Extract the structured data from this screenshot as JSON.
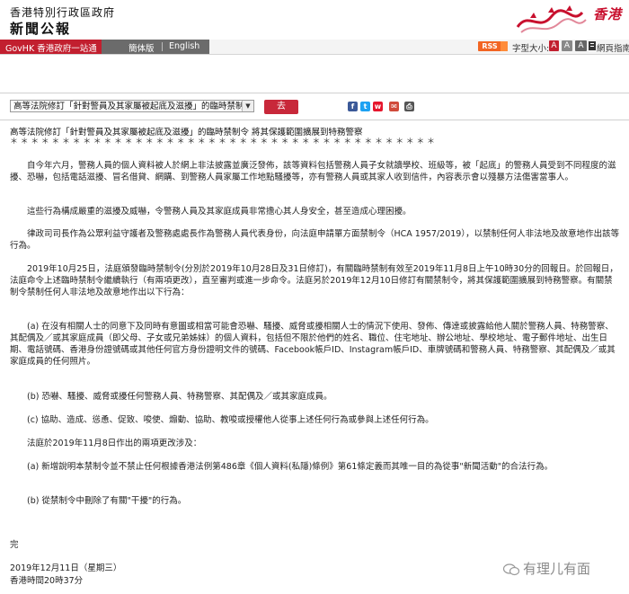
{
  "header": {
    "gov_name": "香港特別行政區政府",
    "site_title": "新聞公報",
    "brand_text": "香港"
  },
  "nav": {
    "gov_link": "GovHK 香港政府一站通",
    "simplified": "簡体版",
    "english": "English",
    "rss": "RSS",
    "font_size_label": "字型大小:",
    "font_small": "A",
    "font_mid": "A",
    "font_large": "A",
    "sitemap": "網頁指南"
  },
  "selector": {
    "selected": "高等法院修訂「針對警員及其家屬被起底及滋擾」的臨時禁制",
    "go_label": "去"
  },
  "share_icons": [
    "facebook-icon",
    "twitter-icon",
    "weibo-icon",
    "email-icon",
    "print-icon"
  ],
  "article": {
    "title": "高等法院修訂「針對警員及其家屬被起底及滋擾」的臨時禁制令 將其保護範圍擴展到特務警察",
    "separator": "＊＊＊＊＊＊＊＊＊＊＊＊＊＊＊＊＊＊＊＊＊＊＊＊＊＊＊＊＊＊＊＊＊＊＊＊＊＊＊＊＊",
    "paragraphs": [
      "　　自今年六月，警務人員的個人資料被人於網上非法披露並廣泛發佈，該等資料包括警務人員子女就讀學校、班級等，被「起底」的警務人員受到不同程度的滋擾、恐嚇，包括電話滋擾、冒名借貸、網購、到警務人員家屬工作地點騷擾等，亦有警務人員或其家人收到信件，內容表示會以殘暴方法傷害當事人。",
      "　　這些行為構成嚴重的滋擾及威嚇，令警務人員及其家庭成員非常擔心其人身安全，甚至造成心理困擾。",
      "　　律政司司長作為公眾利益守護者及警務處處長作為警務人員代表身份，向法庭申請單方面禁制令（HCA 1957/2019），以禁制任何人非法地及故意地作出該等行為。",
      "　　2019年10月25日，法庭頒發臨時禁制令(分別於2019年10月28日及31日修訂)，有關臨時禁制有效至2019年11月8日上午10時30分的回報日。於回報日，法庭命令上述臨時禁制令繼續執行（有兩項更改），直至審判或進一步命令。法庭另於2019年12月10日修訂有關禁制令，將其保護範圍擴展到特務警察。有關禁制令禁制任何人非法地及故意地作出以下行為：",
      "　　(a) 在沒有相關人士的同意下及同時有意圖或相當可能會恐嚇、騷擾、威脅或擾相關人士的情況下使用、發佈、傳達或披露給他人關於警務人員、特務警察、其配偶及／或其家庭成員（即父母、子女或兄弟姊妹）的個人資料，包括但不限於他們的姓名、職位、住宅地址、辦公地址、學校地址、電子郵件地址、出生日期、電話號碼、香港身份證號碼或其他任何官方身份證明文件的號碼、Facebook帳戶ID、Instagram帳戶ID、車牌號碼和警務人員、特務警察、其配偶及／或其家庭成員的任何照片。",
      "　　(b) 恐嚇、騷擾、威脅或擾任何警務人員、特務警察、其配偶及／或其家庭成員。",
      "　　(c) 協助、造成、慫恿、促致、唆使、煽動、協助、教唆或授權他人從事上述任何行為或參與上述任何行為。",
      "　　法庭於2019年11月8日作出的兩項更改涉及：",
      "　　(a) 新增說明本禁制令並不禁止任何根據香港法例第486章《個人資料(私隱)條例》第61條定義而其唯一目的為從事\"新聞活動\"的合法行為。",
      "　　(b) 從禁制令中刪除了有關\"干擾\"的行為。"
    ],
    "end_mark": "完",
    "date": "2019年12月11日（星期三）",
    "time": "香港時間20時37分"
  },
  "watermark": {
    "text": "有理儿有面"
  },
  "colors": {
    "gov_red": "#c21f2f",
    "go_button": "#c8283a",
    "rss_orange": "#f26522"
  }
}
